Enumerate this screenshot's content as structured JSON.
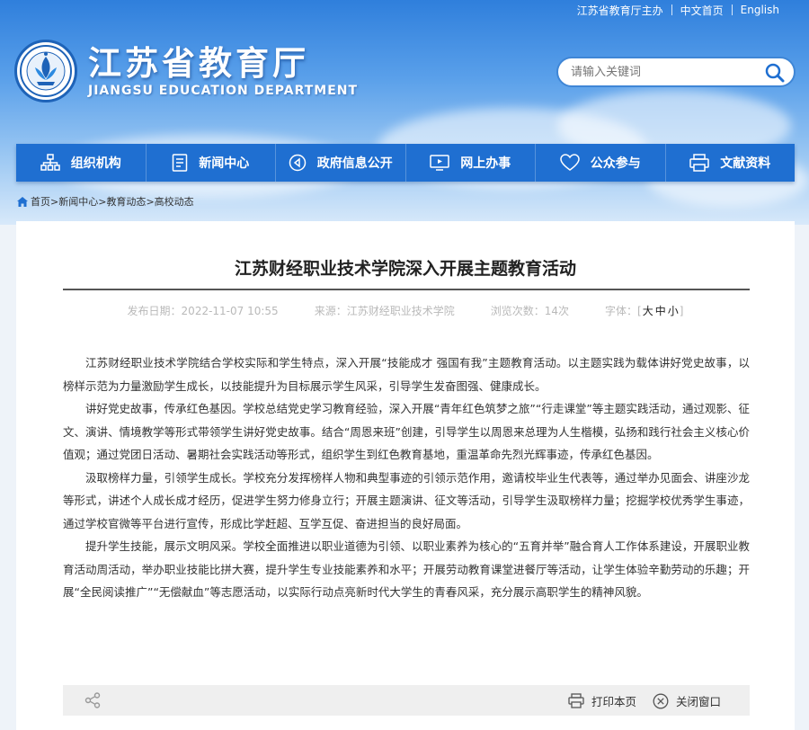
{
  "topbar": {
    "sponsor": "江苏省教育厅主办",
    "home_cn": "中文首页",
    "english": "English"
  },
  "logo": {
    "name_cn": "江苏省教育厅",
    "name_en": "JIANGSU EDUCATION DEPARTMENT"
  },
  "search": {
    "placeholder": "请输入关键词",
    "icon": "search-icon"
  },
  "nav": {
    "items": [
      {
        "label": "组织机构",
        "icon": "org-chart-icon"
      },
      {
        "label": "新闻中心",
        "icon": "document-icon"
      },
      {
        "label": "政府信息公开",
        "icon": "info-disclosure-icon"
      },
      {
        "label": "网上办事",
        "icon": "monitor-icon"
      },
      {
        "label": "公众参与",
        "icon": "heart-icon"
      },
      {
        "label": "文献资料",
        "icon": "printer-icon"
      }
    ]
  },
  "breadcrumb": {
    "home": "首页",
    "items": [
      "新闻中心",
      "教育动态",
      "高校动态"
    ],
    "separator": ">"
  },
  "article": {
    "title": "江苏财经职业技术学院深入开展主题教育活动",
    "meta": {
      "date_label": "发布日期：",
      "date": "2022-11-07 10:55",
      "source_label": "来源：",
      "source": "江苏财经职业技术学院",
      "views_label": "浏览次数：",
      "views": "14次",
      "font_label": "字体：",
      "font_open": "[",
      "font_large": "大",
      "font_medium": "中",
      "font_small": "小",
      "font_close": "]"
    },
    "paragraphs": [
      "江苏财经职业技术学院结合学校实际和学生特点，深入开展“技能成才 强国有我”主题教育活动。以主题实践为载体讲好党史故事，以榜样示范为力量激励学生成长，以技能提升为目标展示学生风采，引导学生发奋图强、健康成长。",
      "讲好党史故事，传承红色基因。学校总结党史学习教育经验，深入开展“青年红色筑梦之旅”“行走课堂”等主题实践活动，通过观影、征文、演讲、情境教学等形式带领学生讲好党史故事。结合“周恩来班”创建，引导学生以周恩来总理为人生楷模，弘扬和践行社会主义核心价值观；通过党团日活动、暑期社会实践活动等形式，组织学生到红色教育基地，重温革命先烈光辉事迹，传承红色基因。",
      "汲取榜样力量，引领学生成长。学校充分发挥榜样人物和典型事迹的引领示范作用，邀请校毕业生代表等，通过举办见面会、讲座沙龙等形式，讲述个人成长成才经历，促进学生努力修身立行；开展主题演讲、征文等活动，引导学生汲取榜样力量；挖掘学校优秀学生事迹，通过学校官微等平台进行宣传，形成比学赶超、互学互促、奋进担当的良好局面。",
      "提升学生技能，展示文明风采。学校全面推进以职业道德为引领、以职业素养为核心的“五育并举”融合育人工作体系建设，开展职业教育活动周活动，举办职业技能比拼大赛，提升学生专业技能素养和水平；开展劳动教育课堂进餐厅等活动，让学生体验辛勤劳动的乐趣；开展“全民阅读推广”“无偿献血”等志愿活动，以实际行动点亮新时代大学生的青春风采，充分展示高职学生的精神风貌。"
    ]
  },
  "footer": {
    "print_label": "打印本页",
    "close_label": "关闭窗口"
  },
  "colors": {
    "nav_bg": "#1f6fd1",
    "header_top": "#2f7fdc",
    "brand_blue": "#1e63b8"
  }
}
